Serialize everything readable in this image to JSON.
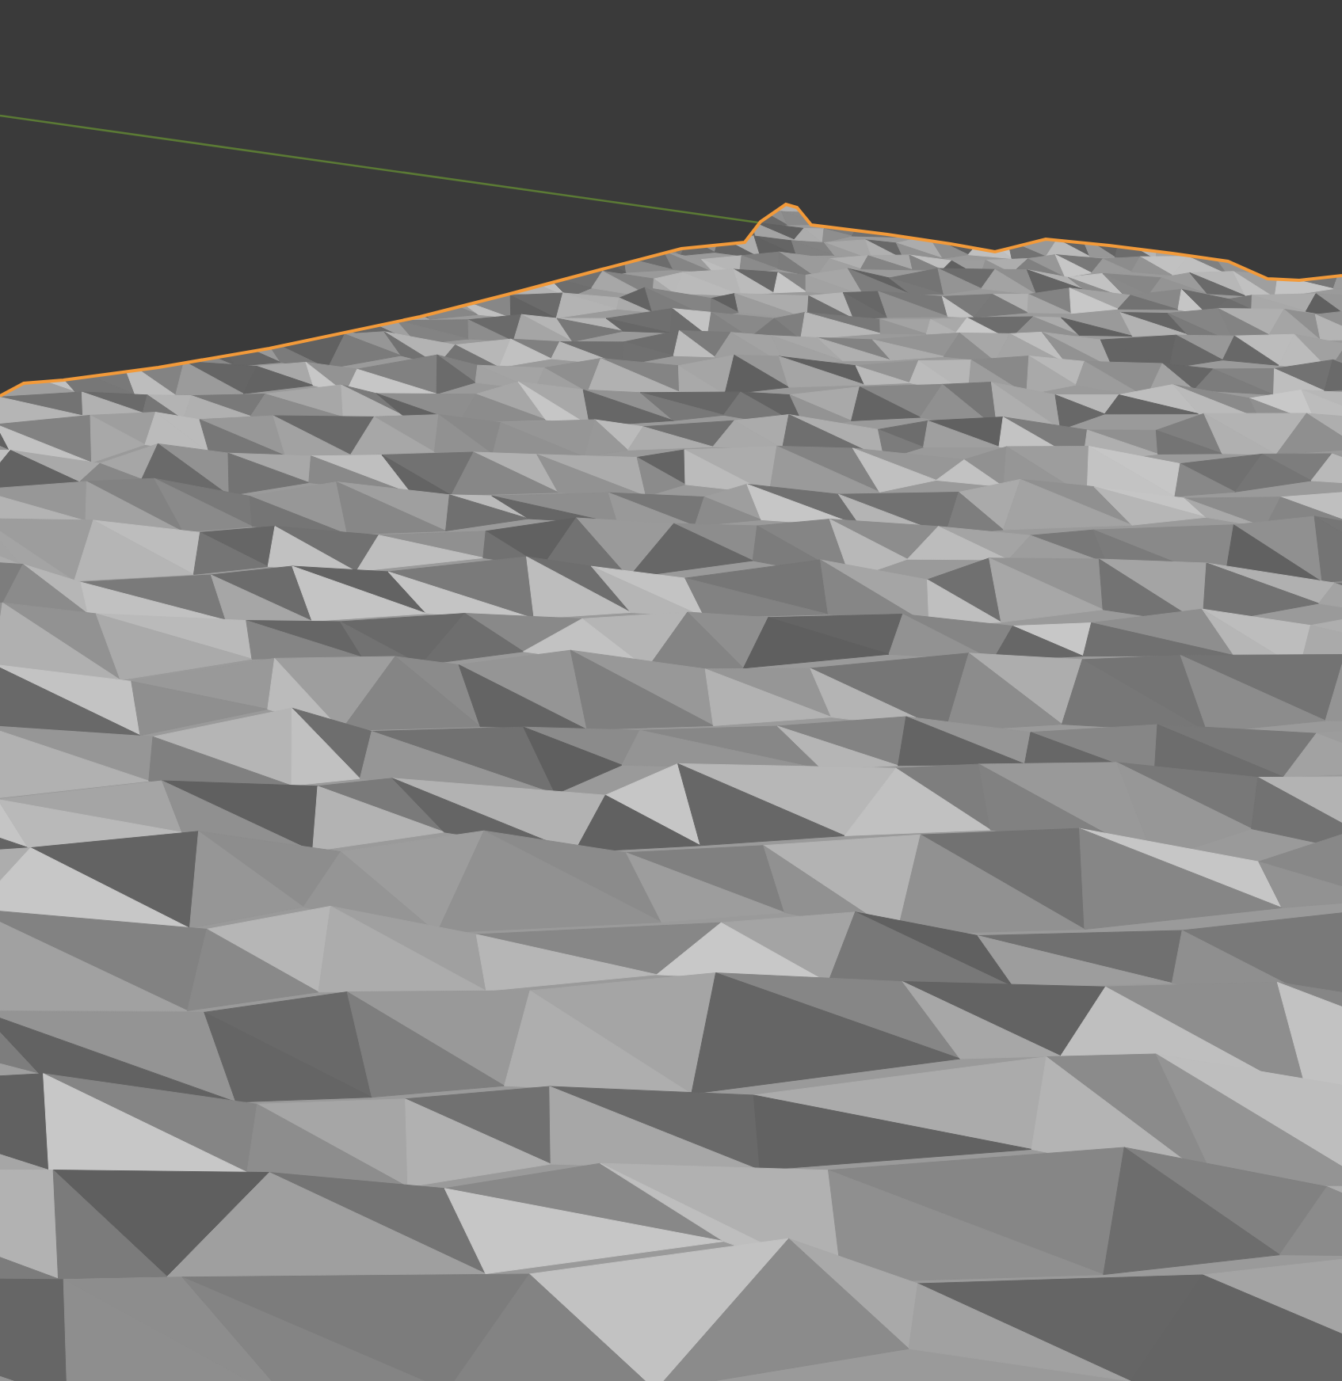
{
  "viewport": {
    "object_selected": true
  }
}
